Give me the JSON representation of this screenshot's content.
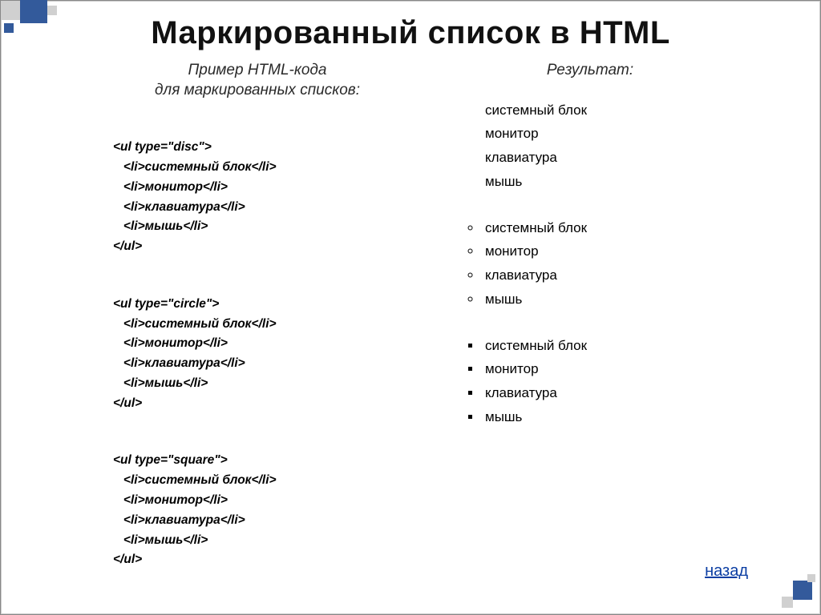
{
  "title": "Маркированный список в HTML",
  "left_heading": "Пример HTML-кода\nдля маркированных списков:",
  "right_heading": "Результат:",
  "code_blocks": [
    {
      "open": "<ul type=\"disc\">",
      "items": [
        "   <li>системный блок</li>",
        "   <li>монитор</li>",
        "   <li>клавиатура</li>",
        "   <li>мышь</li>"
      ],
      "close": "</ul>"
    },
    {
      "open": "<ul type=\"circle\">",
      "items": [
        "   <li>системный блок</li>",
        "   <li>монитор</li>",
        "   <li>клавиатура</li>",
        "   <li>мышь</li>"
      ],
      "close": "</ul>"
    },
    {
      "open": "<ul type=\"square\">",
      "items": [
        "   <li>системный блок</li>",
        "   <li>монитор</li>",
        "   <li>клавиатура</li>",
        "   <li>мышь</li>"
      ],
      "close": "</ul>"
    }
  ],
  "result_lists": [
    {
      "style": "disc",
      "items": [
        "системный блок",
        "монитор",
        "клавиатура",
        "мышь"
      ]
    },
    {
      "style": "circle",
      "items": [
        "системный блок",
        "монитор",
        "клавиатура",
        "мышь"
      ]
    },
    {
      "style": "square",
      "items": [
        "системный блок",
        "монитор",
        "клавиатура",
        "мышь"
      ]
    }
  ],
  "back_link": "назад"
}
